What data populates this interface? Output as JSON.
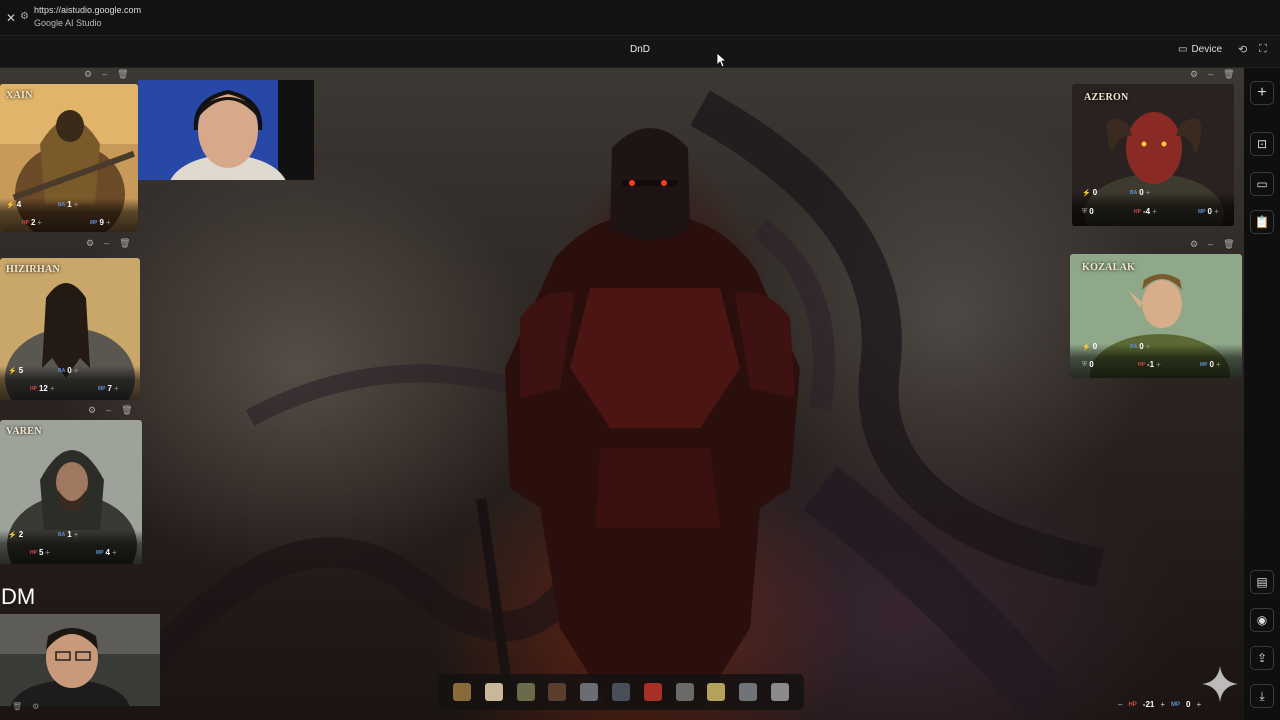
{
  "browser": {
    "url": "https://aistudio.google.com",
    "site_name": "Google AI Studio"
  },
  "app": {
    "title": "DnD",
    "device_label": "Device"
  },
  "webcam_label": "DM",
  "characters": [
    {
      "name": "XAIN",
      "stats": {
        "ap": "4",
        "ba": "1",
        "hp": "2",
        "mp": "9"
      }
    },
    {
      "name": "HIZIRHAN",
      "stats": {
        "ap": "5",
        "ba": "0",
        "hp": "12",
        "mp": "7"
      }
    },
    {
      "name": "VAREN",
      "stats": {
        "ap": "2",
        "ba": "1",
        "hp": "5",
        "mp": "4"
      }
    },
    {
      "name": "AZERON",
      "stats": {
        "ap": "0",
        "ba": "0",
        "ar": "0",
        "hp": "-4",
        "mp": "0"
      }
    },
    {
      "name": "KOZALAK",
      "stats": {
        "ap": "0",
        "ba": "0",
        "ar": "0",
        "hp": "-1",
        "mp": "0"
      }
    }
  ],
  "stat_labels": {
    "ba": "BA",
    "hp": "HP",
    "mp": "MP"
  },
  "party_totals": {
    "hp_label": "HP",
    "hp": "-21",
    "mp_label": "MP",
    "mp": "0"
  },
  "thumbnails": [
    "#8a6a3a",
    "#c9b79a",
    "#6b6a4a",
    "#5a3e2e",
    "#6a6e74",
    "#4a4e58",
    "#a83024",
    "#6a6a6a",
    "#b4a25a",
    "#70747a",
    "#8a8a8a"
  ],
  "colors": {
    "ap": "#e6c229",
    "ba": "#5b8fd6",
    "hp": "#d94848",
    "mp": "#5b8fd6",
    "background": "#0d0d0d"
  }
}
